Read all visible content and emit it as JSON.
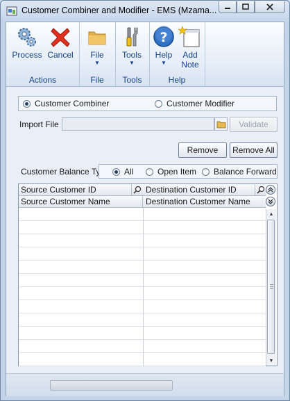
{
  "window": {
    "title": "Customer Combiner and Modifier  -  EMS (Mzama...",
    "controls": {
      "minimize": "—",
      "maximize": "▭",
      "close": "✕"
    }
  },
  "ribbon": {
    "groups": [
      {
        "label": "Actions",
        "buttons": [
          {
            "label": "Process",
            "icon": "gears-icon"
          },
          {
            "label": "Cancel",
            "icon": "red-x-icon"
          }
        ]
      },
      {
        "label": "File",
        "buttons": [
          {
            "label": "File",
            "icon": "folder-icon",
            "dropdown": "▼"
          }
        ]
      },
      {
        "label": "Tools",
        "buttons": [
          {
            "label": "Tools",
            "icon": "tools-icon",
            "dropdown": "▼"
          }
        ]
      },
      {
        "label": "Help",
        "buttons": [
          {
            "label": "Help",
            "icon": "help-icon",
            "dropdown": "▼"
          },
          {
            "label": "Add",
            "label2": "Note",
            "icon": "add-note-icon"
          }
        ]
      }
    ]
  },
  "mode": {
    "options": [
      {
        "label": "Customer Combiner",
        "selected": true
      },
      {
        "label": "Customer Modifier",
        "selected": false
      }
    ]
  },
  "import": {
    "label": "Import File",
    "value": "",
    "validate_label": "Validate"
  },
  "actions": {
    "remove_label": "Remove",
    "remove_all_label": "Remove All"
  },
  "balance_type": {
    "label": "Customer Balance Type",
    "options": [
      {
        "label": "All",
        "selected": true
      },
      {
        "label": "Open Item",
        "selected": false
      },
      {
        "label": "Balance Forward",
        "selected": false
      }
    ]
  },
  "grid": {
    "header1": [
      "Source Customer ID",
      "Destination Customer ID"
    ],
    "header2": [
      "Source Customer Name",
      "Destination Customer Name"
    ],
    "rows": 12
  },
  "progress": {
    "value": 0
  }
}
